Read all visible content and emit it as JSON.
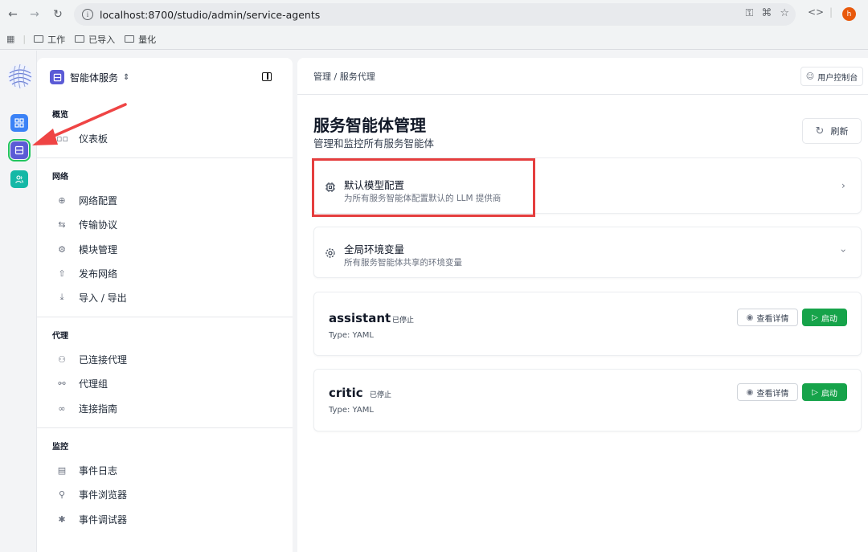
{
  "browser": {
    "url": "localhost:8700/studio/admin/service-agents",
    "profile_initial": "h",
    "bookmarks": [
      "工作",
      "已导入",
      "量化"
    ]
  },
  "sidebar": {
    "title": "智能体服务",
    "sections": [
      {
        "title": "概览",
        "items": [
          {
            "label": "仪表板",
            "icon": "dashboard-icon"
          }
        ]
      },
      {
        "title": "网络",
        "items": [
          {
            "label": "网络配置",
            "icon": "globe-icon"
          },
          {
            "label": "传输协议",
            "icon": "transfer-icon"
          },
          {
            "label": "模块管理",
            "icon": "gear-icon"
          },
          {
            "label": "发布网络",
            "icon": "upload-icon"
          },
          {
            "label": "导入 / 导出",
            "icon": "download-icon"
          }
        ]
      },
      {
        "title": "代理",
        "items": [
          {
            "label": "已连接代理",
            "icon": "users-icon"
          },
          {
            "label": "代理组",
            "icon": "group-icon"
          },
          {
            "label": "连接指南",
            "icon": "link-icon"
          }
        ]
      },
      {
        "title": "监控",
        "items": [
          {
            "label": "事件日志",
            "icon": "file-icon"
          },
          {
            "label": "事件浏览器",
            "icon": "search-icon"
          },
          {
            "label": "事件调试器",
            "icon": "bug-icon"
          }
        ]
      }
    ]
  },
  "main": {
    "breadcrumb": "管理 / 服务代理",
    "console_label": "用户控制台",
    "title": "服务智能体管理",
    "subtitle": "管理和监控所有服务智能体",
    "refresh_label": "刷新",
    "config_cards": [
      {
        "title": "默认模型配置",
        "desc": "为所有服务智能体配置默认的 LLM 提供商"
      },
      {
        "title": "全局环境变量",
        "desc": "所有服务智能体共享的环境变量"
      }
    ],
    "agents": [
      {
        "name": "assistant",
        "status": "已停止",
        "type": "Type: YAML",
        "detail_label": "查看详情",
        "start_label": "启动"
      },
      {
        "name": "critic",
        "status": "已停止",
        "type": "Type: YAML",
        "detail_label": "查看详情",
        "start_label": "启动"
      }
    ]
  },
  "colors": {
    "accent": "#5b5bd6",
    "start_green": "#16a34a",
    "annotation_red": "#e53e3e",
    "rail_blue": "#3b82f6",
    "rail_teal": "#14b8a6"
  }
}
